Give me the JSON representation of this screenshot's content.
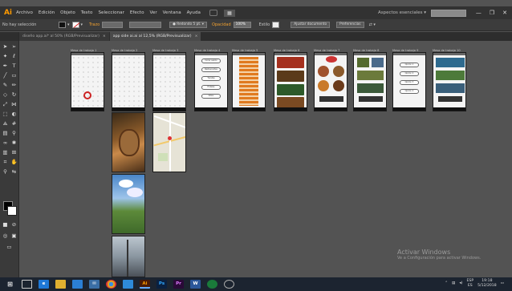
{
  "app": {
    "logo": "Ai",
    "logo_color": "#ff9a00"
  },
  "menubar": {
    "items": [
      "Archivo",
      "Edición",
      "Objeto",
      "Texto",
      "Seleccionar",
      "Efecto",
      "Ver",
      "Ventana",
      "Ayuda"
    ],
    "workspace_label": "Aspectos esenciales",
    "window_controls": [
      "—",
      "❐",
      "✕"
    ]
  },
  "controlbar": {
    "selection_label": "No hay selección",
    "stroke_label": "Trazo",
    "stroke_value": "",
    "brush_value": "Redondo 5 pt.",
    "opacity_label": "Opacidad",
    "opacity_value": "100%",
    "style_label": "Estilo",
    "doc_setup": "Ajustar documento",
    "preferences": "Preferencias",
    "accent_color": "#f0a030"
  },
  "tabs": [
    {
      "label": "diseño app.ai* al 50% (RGB/Previsualizar)",
      "close": "×",
      "active": false
    },
    {
      "label": "app side ai.ai al 12,5% (RGB/Previsualizar)",
      "close": "×",
      "active": true
    }
  ],
  "artboard_labels": [
    "Mesa de trabajo 1",
    "Mesa de trabajo 2",
    "Mesa de trabajo 3",
    "Mesa de trabajo 4",
    "Mesa de trabajo 5",
    "Mesa de trabajo 6",
    "Mesa de trabajo 7",
    "Mesa de trabajo 8",
    "Mesa de trabajo 9",
    "Mesa de trabajo 10"
  ],
  "artboards": {
    "ab4_buttons": [
      "Iniciar sesión",
      "Restaurantes",
      "Tiendas",
      "Hoteles",
      "Sitios"
    ],
    "ab5_menu_color": "#e07a1f",
    "ab9_buttons": [
      "Opción 1",
      "Opción 2",
      "Opción 3",
      "Opción 4"
    ]
  },
  "watermark": {
    "title": "Activar Windows",
    "subtitle": "Ve a Configuración para activar Windows."
  },
  "taskbar": {
    "icons": [
      "windows-start",
      "task-view",
      "edge",
      "file-explorer",
      "store",
      "mail",
      "chrome",
      "calendar",
      "illustrator",
      "photoshop",
      "premiere",
      "word",
      "cortana",
      "search"
    ],
    "lang_top": "ESP",
    "lang_bottom": "ES",
    "time": "19:18",
    "date": "5/12/2018"
  }
}
